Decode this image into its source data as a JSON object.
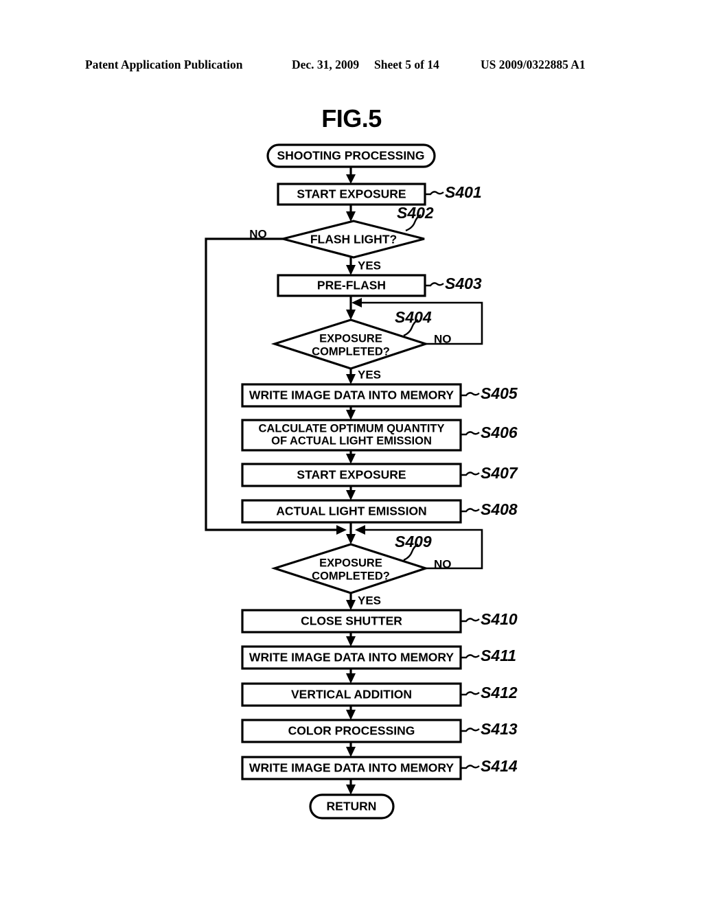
{
  "header": {
    "publication": "Patent Application Publication",
    "date": "Dec. 31, 2009",
    "sheet": "Sheet 5 of 14",
    "document_number": "US 2009/0322885 A1"
  },
  "figure": {
    "title": "FIG.5"
  },
  "flowchart": {
    "nodes": [
      {
        "id": "start",
        "type": "terminal",
        "label": "SHOOTING PROCESSING",
        "step": ""
      },
      {
        "id": "s401",
        "type": "process",
        "label": "START EXPOSURE",
        "step": "S401"
      },
      {
        "id": "s402",
        "type": "decision",
        "label": "FLASH LIGHT?",
        "step": "S402"
      },
      {
        "id": "s403",
        "type": "process",
        "label": "PRE-FLASH",
        "step": "S403"
      },
      {
        "id": "s404",
        "type": "decision",
        "label_line1": "EXPOSURE",
        "label_line2": "COMPLETED?",
        "step": "S404"
      },
      {
        "id": "s405",
        "type": "process",
        "label": "WRITE IMAGE DATA INTO MEMORY",
        "step": "S405"
      },
      {
        "id": "s406",
        "type": "process",
        "label_line1": "CALCULATE OPTIMUM QUANTITY",
        "label_line2": "OF ACTUAL LIGHT EMISSION",
        "step": "S406"
      },
      {
        "id": "s407",
        "type": "process",
        "label": "START EXPOSURE",
        "step": "S407"
      },
      {
        "id": "s408",
        "type": "process",
        "label": "ACTUAL LIGHT EMISSION",
        "step": "S408"
      },
      {
        "id": "s409",
        "type": "decision",
        "label_line1": "EXPOSURE",
        "label_line2": "COMPLETED?",
        "step": "S409"
      },
      {
        "id": "s410",
        "type": "process",
        "label": "CLOSE SHUTTER",
        "step": "S410"
      },
      {
        "id": "s411",
        "type": "process",
        "label": "WRITE IMAGE DATA INTO MEMORY",
        "step": "S411"
      },
      {
        "id": "s412",
        "type": "process",
        "label": "VERTICAL ADDITION",
        "step": "S412"
      },
      {
        "id": "s413",
        "type": "process",
        "label": "COLOR PROCESSING",
        "step": "S413"
      },
      {
        "id": "s414",
        "type": "process",
        "label": "WRITE IMAGE DATA INTO MEMORY",
        "step": "S414"
      },
      {
        "id": "return",
        "type": "terminal",
        "label": "RETURN",
        "step": ""
      }
    ],
    "branch_labels": {
      "s402_no": "NO",
      "s402_yes": "YES",
      "s404_no": "NO",
      "s404_yes": "YES",
      "s409_no": "NO",
      "s409_yes": "YES"
    },
    "colors": {
      "stroke": "#000000",
      "fill": "#ffffff",
      "text": "#000000"
    }
  }
}
